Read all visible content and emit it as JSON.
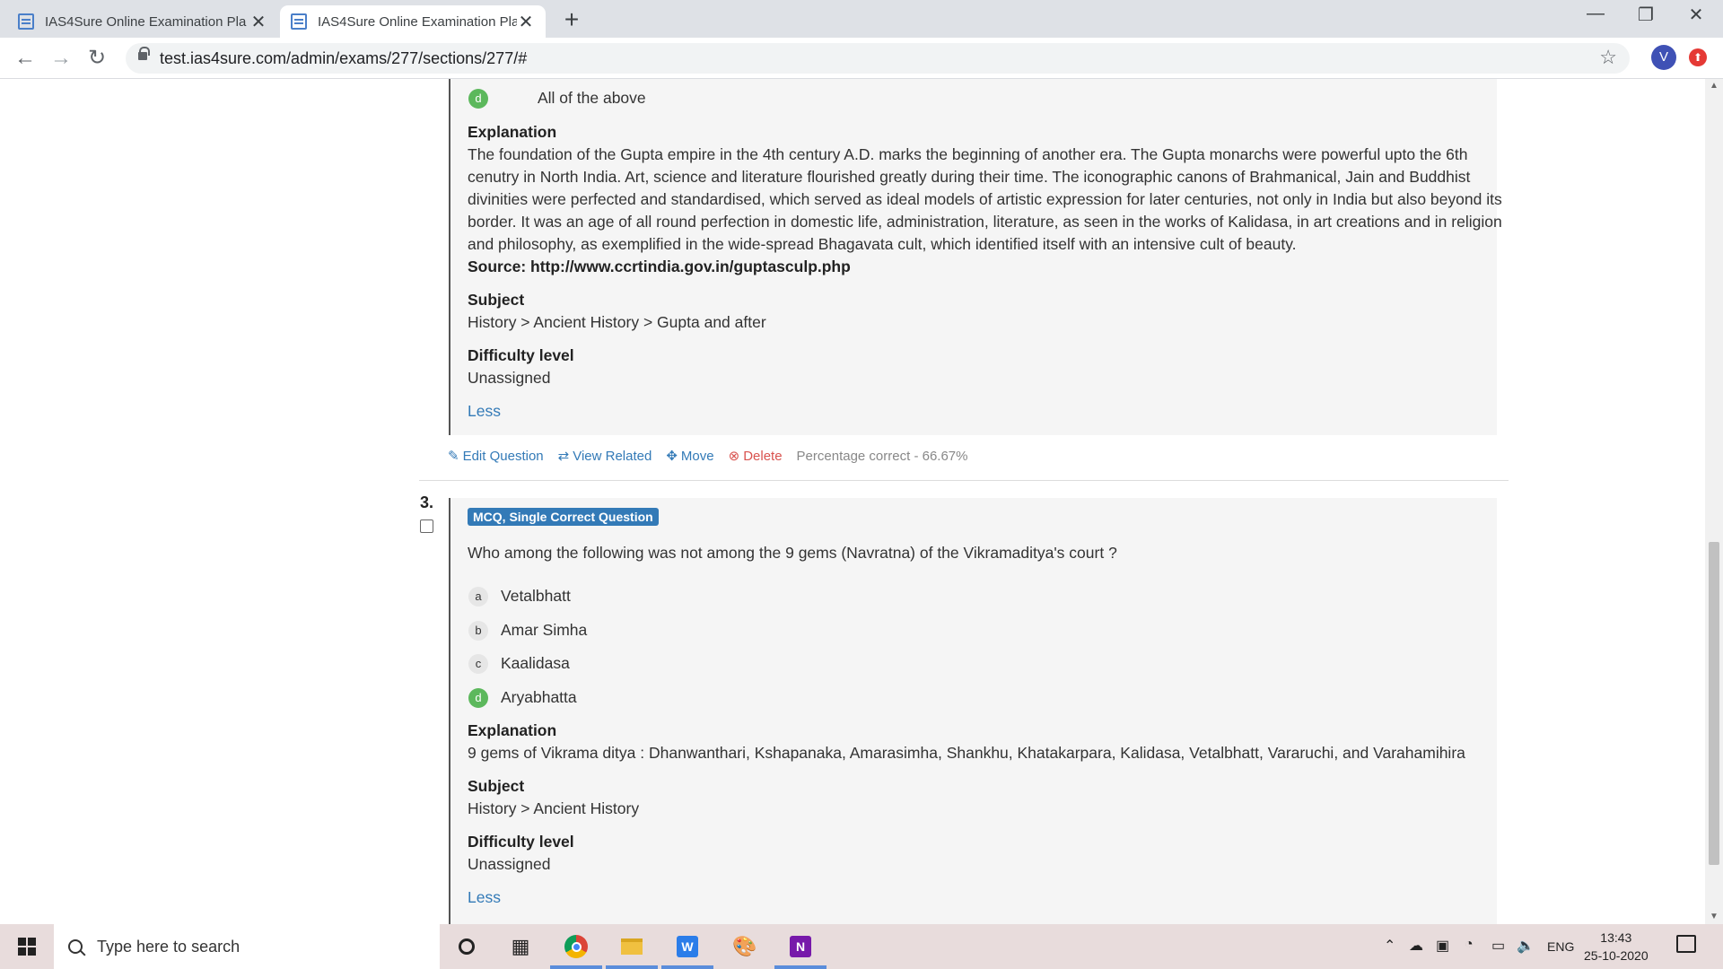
{
  "browser": {
    "tabs": [
      {
        "title": "IAS4Sure Online Examination Pla",
        "active": false
      },
      {
        "title": "IAS4Sure Online Examination Pla",
        "active": true
      }
    ],
    "url": "test.ias4sure.com/admin/exams/277/sections/277/#",
    "profile_initial": "V"
  },
  "question2_tail": {
    "option_d": {
      "letter": "d",
      "text": "All of the above",
      "correct": true
    },
    "explanation_heading": "Explanation",
    "explanation_lines": [
      "The foundation of the Gupta empire in the 4th century A.D. marks the beginning of another era. The Gupta monarchs were powerful upto the 6th",
      "cenutry in North India. Art, science and literature flourished greatly during their time. The iconographic canons of Brahmanical, Jain and Buddhist",
      "divinities were perfected and standardised, which served as ideal models of artistic expression for later centuries, not only in India but also beyond its",
      "border. It was an age of all round perfection in domestic life, administration, literature, as seen in the works of Kalidasa, in art creations and in religion",
      "and philosophy, as exemplified in the wide-spread Bhagavata cult, which identified itself with an intensive cult of beauty."
    ],
    "source": "Source: http://www.ccrtindia.gov.in/guptasculp.php",
    "subject_heading": "Subject",
    "subject": "History > Ancient History > Gupta and after",
    "difficulty_heading": "Difficulty level",
    "difficulty": "Unassigned",
    "less": "Less",
    "actions": {
      "edit": "Edit Question",
      "related": "View Related",
      "move": "Move",
      "delete": "Delete",
      "percentage": "Percentage correct - 66.67%"
    }
  },
  "question3": {
    "number": "3.",
    "type_badge": "MCQ, Single Correct Question",
    "text": "Who among the following was not among the 9 gems (Navratna) of the Vikramaditya's court ?",
    "options": [
      {
        "letter": "a",
        "text": "Vetalbhatt",
        "correct": false
      },
      {
        "letter": "b",
        "text": "Amar Simha",
        "correct": false
      },
      {
        "letter": "c",
        "text": "Kaalidasa",
        "correct": false
      },
      {
        "letter": "d",
        "text": "Aryabhatta",
        "correct": true
      }
    ],
    "explanation_heading": "Explanation",
    "explanation": "9 gems of Vikrama ditya : Dhanwanthari, Kshapanaka, Amarasimha, Shankhu, Khatakarpara, Kalidasa, Vetalbhatt, Vararuchi, and Varahamihira",
    "subject_heading": "Subject",
    "subject": "History > Ancient History",
    "difficulty_heading": "Difficulty level",
    "difficulty": "Unassigned",
    "less": "Less"
  },
  "taskbar": {
    "search_placeholder": "Type here to search",
    "language": "ENG",
    "time": "13:43",
    "date": "25-10-2020"
  },
  "colors": {
    "accent": "#337ab7",
    "correct": "#5cb85c",
    "danger": "#d9534f"
  }
}
